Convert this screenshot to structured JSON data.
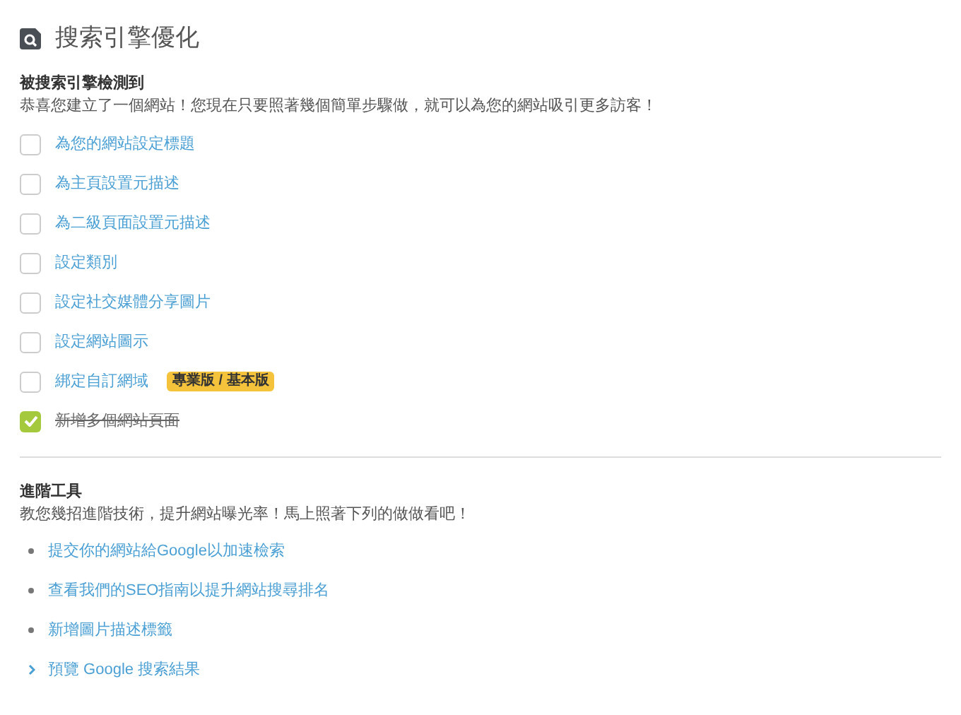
{
  "title": "搜索引擎優化",
  "detect": {
    "heading": "被搜索引擎檢測到",
    "description": "恭喜您建立了一個網站！您現在只要照著幾個簡單步驟做，就可以為您的網站吸引更多訪客！",
    "tasks": [
      {
        "label": "為您的網站設定標題",
        "checked": false
      },
      {
        "label": "為主頁設置元描述",
        "checked": false
      },
      {
        "label": "為二級頁面設置元描述",
        "checked": false
      },
      {
        "label": "設定類別",
        "checked": false
      },
      {
        "label": "設定社交媒體分享圖片",
        "checked": false
      },
      {
        "label": "設定網站圖示",
        "checked": false
      },
      {
        "label": "綁定自訂網域",
        "checked": false,
        "badge": "專業版 / 基本版"
      },
      {
        "label": "新增多個網站頁面",
        "checked": true
      }
    ]
  },
  "advanced": {
    "heading": "進階工具",
    "description": "教您幾招進階技術，提升網站曝光率！馬上照著下列的做做看吧！",
    "links": [
      "提交你的網站給Google以加速檢索",
      "查看我們的SEO指南以提升網站搜尋排名",
      "新增圖片描述標籤"
    ],
    "preview": "預覽 Google 搜索結果"
  }
}
